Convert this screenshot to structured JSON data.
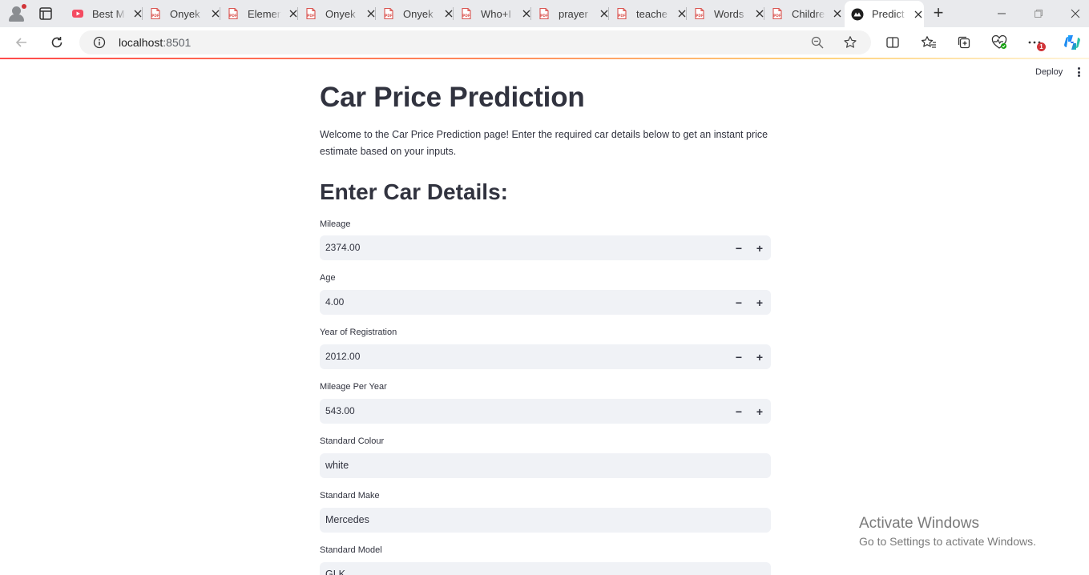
{
  "browser": {
    "tabs": [
      {
        "title": "Best M",
        "icon": "youtube-icon"
      },
      {
        "title": "Onyek",
        "icon": "pdf-icon"
      },
      {
        "title": "Elemen",
        "icon": "pdf-icon"
      },
      {
        "title": "Onyek",
        "icon": "pdf-icon"
      },
      {
        "title": "Onyek",
        "icon": "pdf-icon"
      },
      {
        "title": "Who+I",
        "icon": "pdf-icon"
      },
      {
        "title": "prayer",
        "icon": "pdf-icon"
      },
      {
        "title": "teache",
        "icon": "pdf-icon"
      },
      {
        "title": "Words",
        "icon": "pdf-icon"
      },
      {
        "title": "Childre",
        "icon": "pdf-icon"
      },
      {
        "title": "Predict",
        "icon": "streamlit-icon",
        "active": true
      }
    ],
    "url_host": "localhost",
    "url_port": ":8501",
    "notification_count": "1"
  },
  "header": {
    "deploy_label": "Deploy"
  },
  "page": {
    "title": "Car Price Prediction",
    "intro": "Welcome to the Car Price Prediction page! Enter the required car details below to get an instant price estimate based on your inputs.",
    "section_title": "Enter Car Details:"
  },
  "form": {
    "mileage": {
      "label": "Mileage",
      "value": "2374.00"
    },
    "age": {
      "label": "Age",
      "value": "4.00"
    },
    "year_of_registration": {
      "label": "Year of Registration",
      "value": "2012.00"
    },
    "mileage_per_year": {
      "label": "Mileage Per Year",
      "value": "543.00"
    },
    "standard_colour": {
      "label": "Standard Colour",
      "value": "white"
    },
    "standard_make": {
      "label": "Standard Make",
      "value": "Mercedes"
    },
    "standard_model": {
      "label": "Standard Model",
      "value": "GLK"
    },
    "stepper_minus": "−",
    "stepper_plus": "+"
  },
  "watermark": {
    "line1": "Activate Windows",
    "line2": "Go to Settings to activate Windows."
  },
  "colors": {
    "streamlit_red": "#ff4b4b",
    "input_bg": "#f0f2f6",
    "text": "#31333f"
  }
}
